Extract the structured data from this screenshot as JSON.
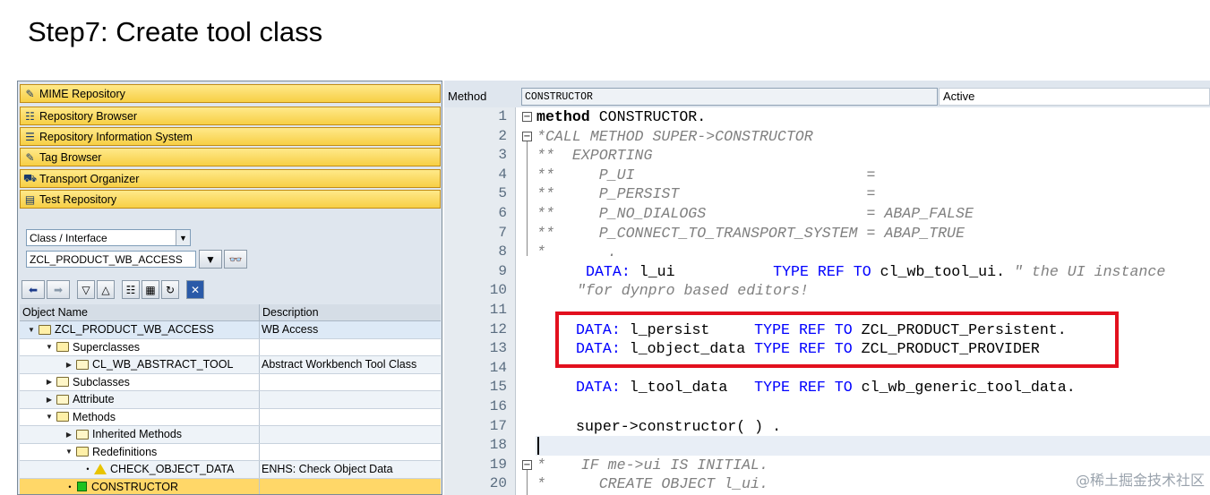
{
  "page": {
    "title": "Step7: Create tool class"
  },
  "nav_buttons": [
    {
      "label": "MIME Repository",
      "icon": "mime-icon"
    },
    {
      "label": "Repository Browser",
      "icon": "hierarchy-icon"
    },
    {
      "label": "Repository Information System",
      "icon": "info-system-icon"
    },
    {
      "label": "Tag Browser",
      "icon": "tag-icon"
    },
    {
      "label": "Transport Organizer",
      "icon": "truck-icon"
    },
    {
      "label": "Test Repository",
      "icon": "test-icon"
    }
  ],
  "object_selector": {
    "type_value": "Class / Interface",
    "name_value": "ZCL_PRODUCT_WB_ACCESS"
  },
  "tree": {
    "columns": [
      "Object Name",
      "Description"
    ],
    "rows": [
      {
        "name": "ZCL_PRODUCT_WB_ACCESS",
        "desc": "WB Access"
      },
      {
        "name": "Superclasses",
        "desc": ""
      },
      {
        "name": "CL_WB_ABSTRACT_TOOL",
        "desc": "Abstract Workbench Tool Class"
      },
      {
        "name": "Subclasses",
        "desc": ""
      },
      {
        "name": "Attribute",
        "desc": ""
      },
      {
        "name": "Methods",
        "desc": ""
      },
      {
        "name": "Inherited Methods",
        "desc": ""
      },
      {
        "name": "Redefinitions",
        "desc": ""
      },
      {
        "name": "CHECK_OBJECT_DATA",
        "desc": "ENHS: Check Object Data"
      },
      {
        "name": "CONSTRUCTOR",
        "desc": ""
      }
    ]
  },
  "editor_header": {
    "label": "Method",
    "method_name": "CONSTRUCTOR",
    "status": "Active"
  },
  "code": {
    "line_numbers": [
      "1",
      "2",
      "3",
      "4",
      "5",
      "6",
      "7",
      "8",
      "9",
      "10",
      "11",
      "12",
      "13",
      "14",
      "15",
      "16",
      "17",
      "18",
      "19",
      "20"
    ],
    "l1_kw": "method",
    "l1_rest": " CONSTRUCTOR.",
    "l2": "*CALL METHOD SUPER->CONSTRUCTOR",
    "l3": "**  EXPORTING",
    "l4": "**     P_UI                          =",
    "l5": "**     P_PERSIST                     =",
    "l6": "**     P_NO_DIALOGS                  = ABAP_FALSE",
    "l7": "**     P_CONNECT_TO_TRANSPORT_SYSTEM = ABAP_TRUE",
    "l8": "*       .",
    "l9_a": "DATA:",
    "l9_b": " l_ui           ",
    "l9_c": "TYPE REF TO",
    "l9_d": " cl_wb_tool_ui. ",
    "l9_e": "\" the UI instance",
    "l10": "\"for dynpro based editors!",
    "l12_a": "DATA:",
    "l12_b": " l_persist     ",
    "l12_c": "TYPE REF TO",
    "l12_d": " ZCL_PRODUCT_Persistent.",
    "l13_a": "DATA:",
    "l13_b": " l_object_data ",
    "l13_c": "TYPE REF TO",
    "l13_d": " ZCL_PRODUCT_PROVIDER",
    "l14": "       .",
    "l15_a": "DATA:",
    "l15_b": " l_tool_data   ",
    "l15_c": "TYPE REF TO",
    "l15_d": " cl_wb_generic_tool_data.",
    "l17": "super->constructor( ) .",
    "l19": "*    IF me->ui IS INITIAL.",
    "l20": "*      CREATE OBJECT l_ui."
  },
  "watermark": "@稀土掘金技术社区"
}
